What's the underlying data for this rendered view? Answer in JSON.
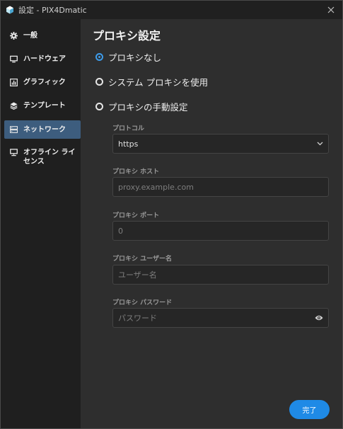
{
  "window": {
    "title": "設定 - PIX4Dmatic"
  },
  "sidebar": {
    "items": [
      {
        "label": "一般",
        "icon": "gear-icon"
      },
      {
        "label": "ハードウェア",
        "icon": "monitor-icon"
      },
      {
        "label": "グラフィック",
        "icon": "chart-icon"
      },
      {
        "label": "テンプレート",
        "icon": "layers-icon"
      },
      {
        "label": "ネットワーク",
        "icon": "network-icon",
        "active": true
      },
      {
        "label": "オフライン ライセンス",
        "icon": "offline-license-icon"
      }
    ]
  },
  "main": {
    "title": "プロキシ設定",
    "options": [
      {
        "label": "プロキシなし",
        "checked": true
      },
      {
        "label": "システム プロキシを使用",
        "checked": false
      },
      {
        "label": "プロキシの手動設定",
        "checked": false
      }
    ],
    "protocol": {
      "label": "プロトコル",
      "value": "https"
    },
    "host": {
      "label": "プロキシ ホスト",
      "placeholder": "proxy.example.com"
    },
    "port": {
      "label": "プロキシ ポート",
      "placeholder": "0"
    },
    "username": {
      "label": "プロキシ ユーザー名",
      "placeholder": "ユーザー名"
    },
    "password": {
      "label": "プロキシ パスワード",
      "placeholder": "パスワード"
    },
    "done_label": "完了"
  },
  "colors": {
    "accent": "#1f8ae6",
    "active_nav": "#3d5d7e",
    "window_bg": "#2e2e2e",
    "sidebar_bg": "#1f1f1f"
  }
}
